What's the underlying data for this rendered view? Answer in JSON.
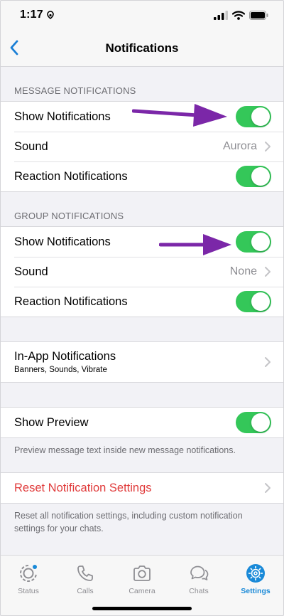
{
  "status_bar": {
    "time": "1:17"
  },
  "nav": {
    "title": "Notifications"
  },
  "message_notifications": {
    "header": "MESSAGE NOTIFICATIONS",
    "show_label": "Show Notifications",
    "show_on": true,
    "sound_label": "Sound",
    "sound_value": "Aurora",
    "reaction_label": "Reaction Notifications",
    "reaction_on": true
  },
  "group_notifications": {
    "header": "GROUP NOTIFICATIONS",
    "show_label": "Show Notifications",
    "show_on": true,
    "sound_label": "Sound",
    "sound_value": "None",
    "reaction_label": "Reaction Notifications",
    "reaction_on": true
  },
  "in_app": {
    "label": "In-App Notifications",
    "subtitle": "Banners, Sounds, Vibrate"
  },
  "preview": {
    "label": "Show Preview",
    "on": true,
    "footnote": "Preview message text inside new message notifications."
  },
  "reset": {
    "label": "Reset Notification Settings",
    "footnote": "Reset all notification settings, including custom notification settings for your chats."
  },
  "tabs": [
    {
      "label": "Status",
      "icon": "status-icon",
      "active": false
    },
    {
      "label": "Calls",
      "icon": "phone-icon",
      "active": false
    },
    {
      "label": "Camera",
      "icon": "camera-icon",
      "active": false
    },
    {
      "label": "Chats",
      "icon": "chats-icon",
      "active": false
    },
    {
      "label": "Settings",
      "icon": "gear-icon",
      "active": true
    }
  ],
  "colors": {
    "toggle_on": "#34c759",
    "accent": "#1a8ad8",
    "destructive": "#e03a3a",
    "arrow": "#7b27a8"
  }
}
